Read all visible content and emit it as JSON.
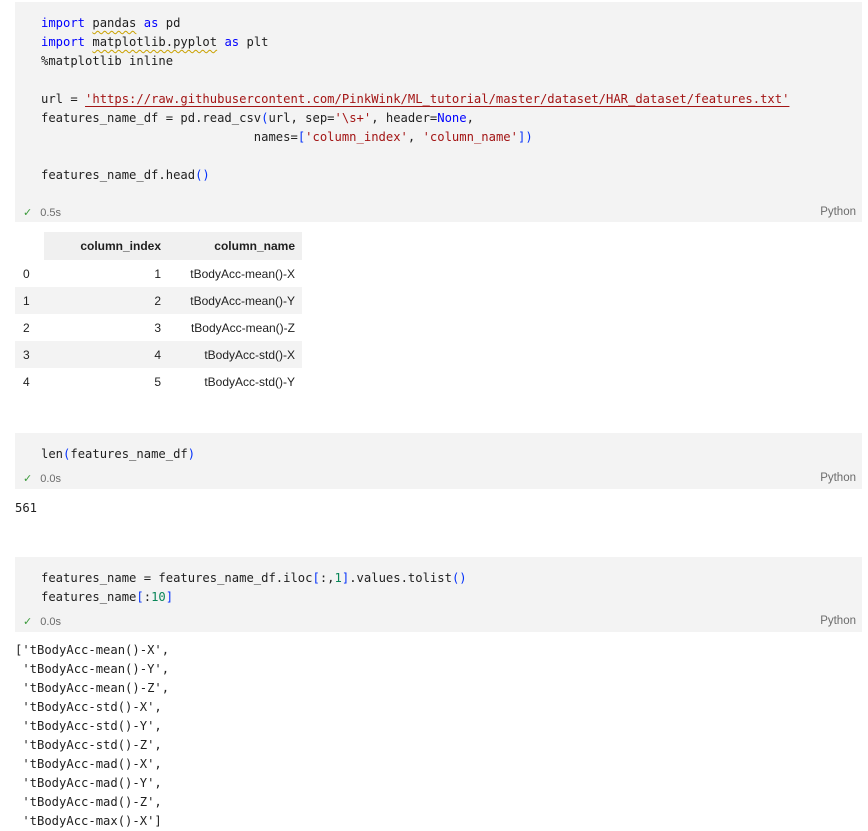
{
  "cell1": {
    "lines": [
      [
        {
          "t": "import",
          "c": "kw"
        },
        {
          "t": " "
        },
        {
          "t": "pandas",
          "c": "squig"
        },
        {
          "t": " "
        },
        {
          "t": "as",
          "c": "kw"
        },
        {
          "t": " pd"
        }
      ],
      [
        {
          "t": "import",
          "c": "kw"
        },
        {
          "t": " "
        },
        {
          "t": "matplotlib.pyplot",
          "c": "squig"
        },
        {
          "t": " "
        },
        {
          "t": "as",
          "c": "kw"
        },
        {
          "t": " plt"
        }
      ],
      [
        {
          "t": "%matplotlib inline"
        }
      ],
      [
        {
          "t": ""
        }
      ],
      [
        {
          "t": "url = "
        },
        {
          "t": "'https://raw.githubusercontent.com/PinkWink/ML_tutorial/master/dataset/HAR_dataset/features.txt'",
          "c": "str urlu"
        }
      ],
      [
        {
          "t": "features_name_df = pd.read_csv"
        },
        {
          "t": "(",
          "c": "paren"
        },
        {
          "t": "url, sep="
        },
        {
          "t": "'\\s+'",
          "c": "str"
        },
        {
          "t": ", header="
        },
        {
          "t": "None",
          "c": "kw"
        },
        {
          "t": ","
        }
      ],
      [
        {
          "t": "                             names="
        },
        {
          "t": "[",
          "c": "paren"
        },
        {
          "t": "'column_index'",
          "c": "str"
        },
        {
          "t": ", "
        },
        {
          "t": "'column_name'",
          "c": "str"
        },
        {
          "t": "]",
          "c": "paren"
        },
        {
          "t": ")",
          "c": "paren"
        }
      ],
      [
        {
          "t": ""
        }
      ],
      [
        {
          "t": "features_name_df.head"
        },
        {
          "t": "()",
          "c": "paren"
        }
      ]
    ],
    "time": "0.5s",
    "lang": "Python"
  },
  "table": {
    "headers": [
      "",
      "column_index",
      "column_name"
    ],
    "rows": [
      [
        "0",
        "1",
        "tBodyAcc-mean()-X"
      ],
      [
        "1",
        "2",
        "tBodyAcc-mean()-Y"
      ],
      [
        "2",
        "3",
        "tBodyAcc-mean()-Z"
      ],
      [
        "3",
        "4",
        "tBodyAcc-std()-X"
      ],
      [
        "4",
        "5",
        "tBodyAcc-std()-Y"
      ]
    ]
  },
  "cell2": {
    "lines": [
      [
        {
          "t": "len"
        },
        {
          "t": "(",
          "c": "paren"
        },
        {
          "t": "features_name_df"
        },
        {
          "t": ")",
          "c": "paren"
        }
      ]
    ],
    "time": "0.0s",
    "lang": "Python",
    "output": "561"
  },
  "cell3": {
    "lines": [
      [
        {
          "t": "features_name = features_name_df.iloc"
        },
        {
          "t": "[",
          "c": "paren"
        },
        {
          "t": ":,"
        },
        {
          "t": "1",
          "c": "num"
        },
        {
          "t": "]",
          "c": "paren"
        },
        {
          "t": ".values.tolist"
        },
        {
          "t": "()",
          "c": "paren"
        }
      ],
      [
        {
          "t": "features_name"
        },
        {
          "t": "[",
          "c": "paren"
        },
        {
          "t": ":",
          "c": ""
        },
        {
          "t": "10",
          "c": "num"
        },
        {
          "t": "]",
          "c": "paren"
        }
      ]
    ],
    "time": "0.0s",
    "lang": "Python",
    "output": "['tBodyAcc-mean()-X',\n 'tBodyAcc-mean()-Y',\n 'tBodyAcc-mean()-Z',\n 'tBodyAcc-std()-X',\n 'tBodyAcc-std()-Y',\n 'tBodyAcc-std()-Z',\n 'tBodyAcc-mad()-X',\n 'tBodyAcc-mad()-Y',\n 'tBodyAcc-mad()-Z',\n 'tBodyAcc-max()-X']"
  },
  "icons": {
    "status": "check-icon"
  }
}
